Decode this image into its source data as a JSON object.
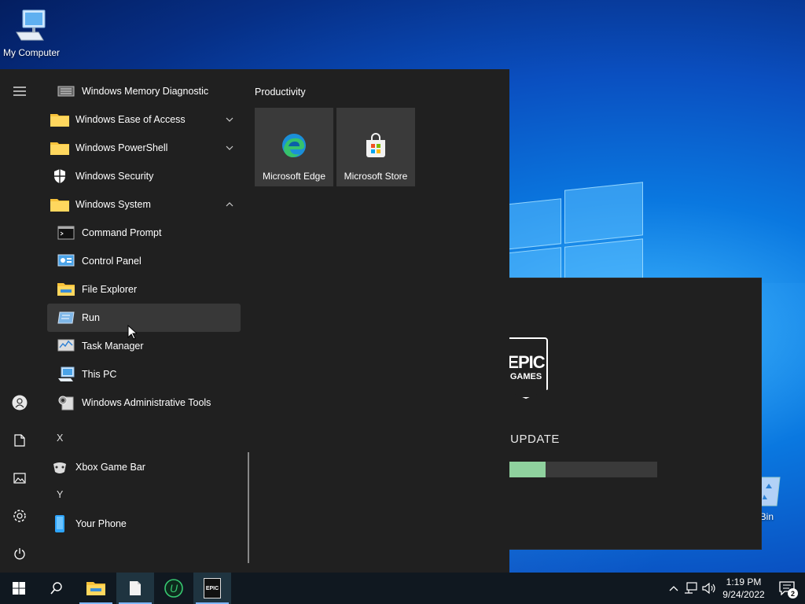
{
  "desktop": {
    "icons": [
      {
        "label": "My Computer"
      },
      {
        "label": "cle Bin"
      }
    ]
  },
  "epic_launcher": {
    "logo_top": "EPIC",
    "logo_bottom": "GAMES",
    "status": "NG UPDATE",
    "progress": 0.34,
    "progress_color": "#8fd19e"
  },
  "start_menu": {
    "rail": [
      "menu-icon",
      "user-icon",
      "documents-icon",
      "pictures-icon",
      "settings-icon",
      "power-icon"
    ],
    "apps": [
      {
        "label": "Windows Memory Diagnostic",
        "type": "child",
        "icon": "memory-diagnostic-icon"
      },
      {
        "label": "Windows Ease of Access",
        "type": "folder",
        "icon": "folder-icon",
        "chevron": "down"
      },
      {
        "label": "Windows PowerShell",
        "type": "folder",
        "icon": "folder-icon",
        "chevron": "down"
      },
      {
        "label": "Windows Security",
        "type": "app",
        "icon": "shield-icon"
      },
      {
        "label": "Windows System",
        "type": "folder",
        "icon": "folder-icon",
        "chevron": "up"
      },
      {
        "label": "Command Prompt",
        "type": "child",
        "icon": "command-prompt-icon"
      },
      {
        "label": "Control Panel",
        "type": "child",
        "icon": "control-panel-icon"
      },
      {
        "label": "File Explorer",
        "type": "child",
        "icon": "file-explorer-icon"
      },
      {
        "label": "Run",
        "type": "child",
        "icon": "run-icon",
        "hover": true
      },
      {
        "label": "Task Manager",
        "type": "child",
        "icon": "task-manager-icon"
      },
      {
        "label": "This PC",
        "type": "child",
        "icon": "this-pc-icon"
      },
      {
        "label": "Windows Administrative Tools",
        "type": "child",
        "icon": "admin-tools-icon"
      }
    ],
    "letter_x": "X",
    "app_xbox": "Xbox Game Bar",
    "letter_y": "Y",
    "app_phone": "Your Phone",
    "tiles_group": "Productivity",
    "tiles": [
      {
        "label": "Microsoft Edge",
        "icon": "edge-icon"
      },
      {
        "label": "Microsoft Store",
        "icon": "store-icon"
      }
    ]
  },
  "taskbar": {
    "buttons": [
      "start-icon",
      "search-icon",
      "file-explorer-icon",
      "notepad-icon",
      "upwork-icon",
      "epic-games-icon"
    ],
    "epic_icon_text": "EPIC",
    "time": "1:19 PM",
    "date": "9/24/2022",
    "notification_count": "2"
  }
}
